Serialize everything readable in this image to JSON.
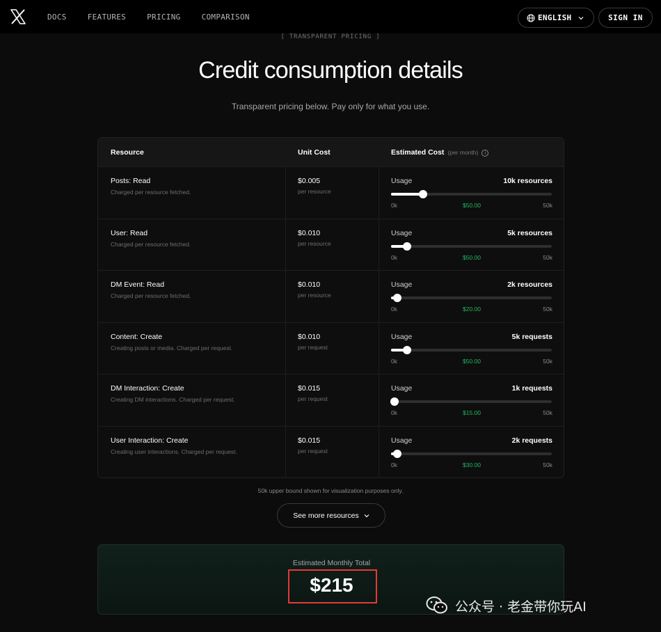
{
  "nav": {
    "links": [
      "DOCS",
      "FEATURES",
      "PRICING",
      "COMPARISON"
    ],
    "language": "ENGLISH",
    "sign_in": "SIGN IN"
  },
  "hero": {
    "eyebrow": "[ TRANSPARENT PRICING ]",
    "title": "Credit consumption details",
    "subtitle": "Transparent pricing below. Pay only for what you use."
  },
  "table": {
    "headers": {
      "resource": "Resource",
      "unit_cost": "Unit Cost",
      "estimated_cost": "Estimated Cost",
      "per_month": "(per month)",
      "info": "i"
    },
    "rows": [
      {
        "name": "Posts: Read",
        "desc": "Charged per resource fetched.",
        "cost": "$0.005",
        "unit": "per resource",
        "usage_label": "Usage",
        "usage": "10k resources",
        "level": 0.2,
        "min": "0k",
        "est": "$50.00",
        "max": "50k"
      },
      {
        "name": "User: Read",
        "desc": "Charged per resource fetched.",
        "cost": "$0.010",
        "unit": "per resource",
        "usage_label": "Usage",
        "usage": "5k resources",
        "level": 0.1,
        "min": "0k",
        "est": "$50.00",
        "max": "50k"
      },
      {
        "name": "DM Event: Read",
        "desc": "Charged per resource fetched.",
        "cost": "$0.010",
        "unit": "per resource",
        "usage_label": "Usage",
        "usage": "2k resources",
        "level": 0.04,
        "min": "0k",
        "est": "$20.00",
        "max": "50k"
      },
      {
        "name": "Content: Create",
        "desc": "Creating posts or media. Charged per request.",
        "cost": "$0.010",
        "unit": "per request",
        "usage_label": "Usage",
        "usage": "5k requests",
        "level": 0.1,
        "min": "0k",
        "est": "$50.00",
        "max": "50k"
      },
      {
        "name": "DM Interaction: Create",
        "desc": "Creating DM interactions. Charged per request.",
        "cost": "$0.015",
        "unit": "per request",
        "usage_label": "Usage",
        "usage": "1k requests",
        "level": 0.02,
        "min": "0k",
        "est": "$15.00",
        "max": "50k"
      },
      {
        "name": "User Interaction: Create",
        "desc": "Creating user interactions. Charged per request.",
        "cost": "$0.015",
        "unit": "per request",
        "usage_label": "Usage",
        "usage": "2k requests",
        "level": 0.04,
        "min": "0k",
        "est": "$30.00",
        "max": "50k"
      }
    ]
  },
  "footnote": "50k upper bound shown for visualization purposes only.",
  "more_button": "See more resources",
  "total": {
    "label": "Estimated Monthly Total",
    "value": "$215"
  },
  "watermark": "公众号 · 老金带你玩AI",
  "colors": {
    "accent_green": "#22b864",
    "highlight_red": "#e53935"
  }
}
